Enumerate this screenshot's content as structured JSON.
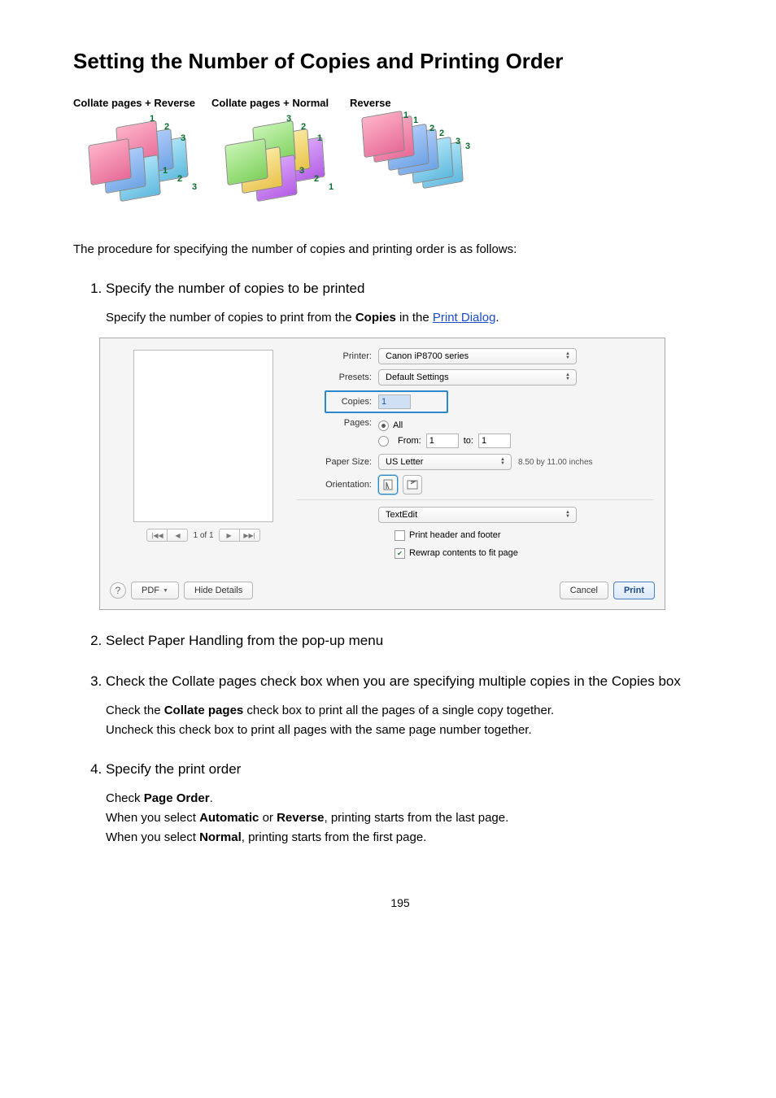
{
  "page_number": "195",
  "heading": "Setting the Number of Copies and Printing Order",
  "option_labels": {
    "a": "Collate pages + Reverse",
    "b": "Collate pages + Normal",
    "c": "Reverse"
  },
  "graphics": {
    "g1": {
      "tags": [
        "1",
        "2",
        "3",
        "1",
        "2",
        "3"
      ]
    },
    "g2": {
      "tags": [
        "3",
        "2",
        "1",
        "3",
        "2",
        "1"
      ]
    },
    "g3": {
      "tags": [
        "1",
        "1",
        "2",
        "2",
        "3",
        "3"
      ]
    }
  },
  "intro_text": "The procedure for specifying the number of copies and printing order is as follows:",
  "step1": {
    "title": "Specify the number of copies to be printed",
    "body_pre": "Specify the number of copies to print from the ",
    "body_bold": "Copies",
    "body_mid": " in the ",
    "body_link": "Print Dialog",
    "body_post": "."
  },
  "dialog": {
    "printer_label": "Printer:",
    "printer_value": "Canon iP8700 series",
    "presets_label": "Presets:",
    "presets_value": "Default Settings",
    "copies_label": "Copies:",
    "copies_value": "1",
    "pages_label": "Pages:",
    "pages_all": "All",
    "pages_from_label": "From:",
    "pages_from_value": "1",
    "pages_to_label": "to:",
    "pages_to_value": "1",
    "papersize_label": "Paper Size:",
    "papersize_value": "US Letter",
    "papersize_dim": "8.50 by 11.00 inches",
    "orientation_label": "Orientation:",
    "pane_name": "TextEdit",
    "header_footer": "Print header and footer",
    "rewrap": "Rewrap contents to fit page",
    "nav_text": "1 of 1",
    "help": "?",
    "pdf": "PDF",
    "hide_details": "Hide Details",
    "cancel": "Cancel",
    "print": "Print"
  },
  "step2": {
    "title_pre": "Select ",
    "title_bold": "Paper Handling",
    "title_post": " from the pop-up menu"
  },
  "step3": {
    "title_pre": "Check the ",
    "title_bold1": "Collate pages",
    "title_mid": " check box when you are specifying multiple copies in the ",
    "title_bold2": "Copies",
    "title_post": " box",
    "body1_pre": "Check the ",
    "body1_bold": "Collate pages",
    "body1_post": " check box to print all the pages of a single copy together.",
    "body2": "Uncheck this check box to print all pages with the same page number together."
  },
  "step4": {
    "title": "Specify the print order",
    "body1_pre": "Check ",
    "body1_bold": "Page Order",
    "body1_post": ".",
    "body2_pre": "When you select ",
    "body2_bold1": "Automatic",
    "body2_or": " or ",
    "body2_bold2": "Reverse",
    "body2_post": ", printing starts from the last page.",
    "body3_pre": "When you select ",
    "body3_bold": "Normal",
    "body3_post": ", printing starts from the first page."
  }
}
